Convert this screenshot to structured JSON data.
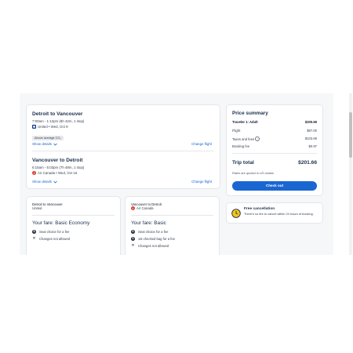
{
  "trip": {
    "outbound": {
      "title": "Detroit to Vancouver",
      "times": "7:00am - 1:12pm (8h 42m, 1 stop)",
      "airline_date": "United • Wed, Oct 9",
      "badge": "Above average CO₂",
      "show_details": "Show details",
      "change_flight": "Change flight"
    },
    "return": {
      "title": "Vancouver to Detroit",
      "times": "6:15am - 5:03pm (7h 48m, 1 stop)",
      "airline_date": "Air Canada • Wed, Oct 16",
      "show_details": "Show details",
      "change_flight": "Change flight"
    }
  },
  "price": {
    "title": "Price summary",
    "traveler_label": "Traveler 1: Adult",
    "traveler_value": "$200.69",
    "flight_label": "Flight",
    "flight_value": "$97.00",
    "taxes_label": "Taxes and fees",
    "taxes_value": "$103.69",
    "booking_label": "Booking fee",
    "booking_value": "$0.97",
    "total_label": "Trip total",
    "total_value": "$201.66",
    "note": "Rates are quoted in US dollars",
    "checkout": "Check out"
  },
  "cancellation": {
    "title": "Free cancellation",
    "text": "There's no fee to cancel within 24 hours of booking."
  },
  "fares": [
    {
      "route": "Detroit to Vancouver",
      "airline": "United",
      "name": "Your fare: Basic Economy",
      "features": [
        "Seat choice for a fee",
        "Changes not allowed"
      ]
    },
    {
      "route": "Vancouver to Detroit",
      "airline": "Air Canada",
      "name": "Your fare: Basic",
      "features": [
        "Seat choice for a fee",
        "1st checked bag for a fee",
        "Changes not allowed"
      ]
    }
  ],
  "colors": {
    "accent": "#1a66d2",
    "heading": "#1b2f4e",
    "air_canada": "#d52b1e",
    "united": "#0b3d91"
  }
}
